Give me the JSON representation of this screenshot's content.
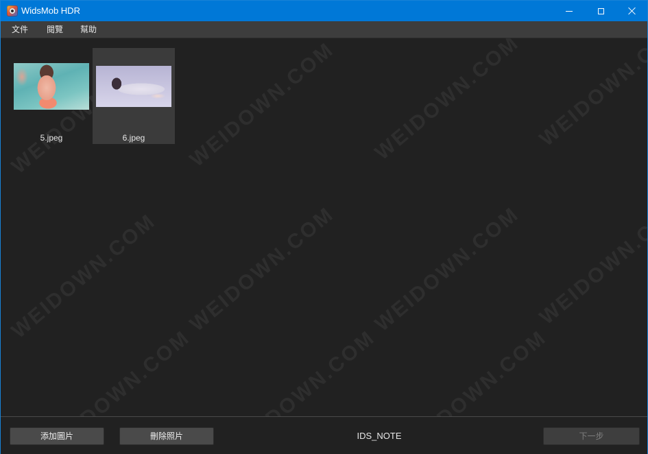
{
  "window": {
    "title": "WidsMob HDR",
    "icon": "app-icon"
  },
  "menu": {
    "items": [
      {
        "label": "文件"
      },
      {
        "label": "閱覽"
      },
      {
        "label": "幫助"
      }
    ]
  },
  "thumbnails": [
    {
      "filename": "5.jpeg",
      "selected": false
    },
    {
      "filename": "6.jpeg",
      "selected": true
    }
  ],
  "watermark": "WEIDOWN.COM",
  "footer": {
    "add_label": "添加圖片",
    "delete_label": "刪除照片",
    "note": "IDS_NOTE",
    "next_label": "下一步",
    "next_enabled": false
  },
  "colors": {
    "titlebar": "#0078d7",
    "menubar": "#3d3d3d",
    "background": "#212121",
    "selected_cell": "#3b3b3b",
    "button": "#4a4a4a"
  }
}
